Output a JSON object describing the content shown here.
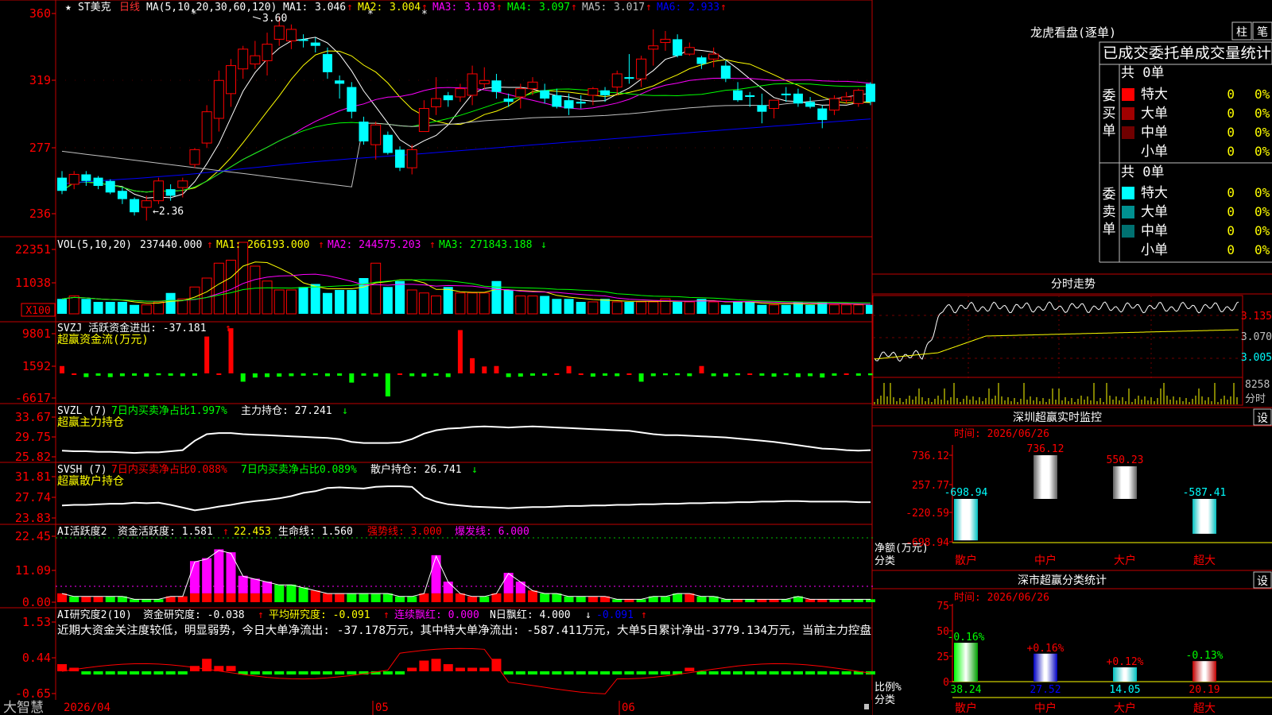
{
  "app": {
    "brand": "大智慧",
    "star": "★"
  },
  "stock": {
    "name": "ST美克",
    "period": "日线",
    "ma_header": "MA(5,10,20,30,60,120)",
    "ma": [
      {
        "label": "MA1:",
        "value": "3.046",
        "color": "#ffffff"
      },
      {
        "label": "MA2:",
        "value": "3.004",
        "color": "#ffff00"
      },
      {
        "label": "MA3:",
        "value": "3.103",
        "color": "#ff00ff"
      },
      {
        "label": "MA4:",
        "value": "3.097",
        "color": "#00ff00"
      },
      {
        "label": "MA5:",
        "value": "3.017",
        "color": "#c0c0c0"
      },
      {
        "label": "MA6:",
        "value": "2.933",
        "color": "#0000ff"
      }
    ],
    "high_marker": "3.60",
    "low_marker": "2.36",
    "arrow_up": "↑",
    "arrow_down": "↓"
  },
  "price_axis": [
    "360",
    "319",
    "277",
    "236"
  ],
  "vol_panel": {
    "title": "VOL(5,10,20)",
    "value": "237440.000",
    "ma1": "MA1: 266193.000",
    "ma2": "MA2: 244575.203",
    "ma3": "MA3: 271843.188",
    "axis": [
      "22351",
      "11038",
      "X100"
    ]
  },
  "svzj_panel": {
    "title": "SVZJ  活跃资金进出: -37.181",
    "subtitle": "超赢资金流(万元)",
    "axis": [
      "9801",
      "1592",
      "-6617"
    ]
  },
  "svzl_panel": {
    "title": "SVZL (7)",
    "net": "7日内买卖净占比1.997%",
    "main": "主力持仓: 27.241",
    "subtitle": "超赢主力持仓",
    "axis": [
      "33.67",
      "29.75",
      "25.82"
    ]
  },
  "svsh_panel": {
    "title": "SVSH (7)",
    "net1": "7日内买卖净占比0.088%",
    "net2": "7日内买卖净占比0.089%",
    "retail": "散户持仓: 26.741",
    "subtitle": "超赢散户持仓",
    "axis": [
      "31.81",
      "27.74",
      "23.83"
    ]
  },
  "ai_active_panel": {
    "title": "AI活跃度2",
    "degree": "资金活跃度: 1.581",
    "v2": "22.453",
    "life": "生命线: 1.560",
    "strong": "强势线: 3.000",
    "burst": "爆发线: 6.000",
    "axis": [
      "22.45",
      "11.09",
      "0.00"
    ]
  },
  "ai_research_panel": {
    "title": "AI研究度2(10)",
    "research": "资金研究度: -0.038",
    "avg": "平均研究度: -0.091",
    "red": "连续飘红: 0.000",
    "nred": "N日飘红: 4.000",
    "last": "-0.091",
    "comment": "近期大资金关注度较低，明显弱势，今日大单净流出: -37.178万元，其中特大单净流出: -587.411万元，大单5日累计净出-3779.134万元，当前主力控盘",
    "axis": [
      "1.53",
      "0.44",
      "-0.65"
    ]
  },
  "date_axis": [
    "2026/04",
    "05",
    "06"
  ],
  "lhkp": {
    "title": "龙虎看盘(逐单)",
    "btn1": "柱",
    "btn2": "笔",
    "subtitle": "已成交委托单成交量统计",
    "buy_label": "委买单",
    "sell_label": "委卖单",
    "buy_total": "共 0单",
    "sell_total": "共 0单",
    "buy_rows": [
      {
        "name": "特大",
        "count": "0",
        "pct": "0%",
        "color": "#ff0000"
      },
      {
        "name": "大单",
        "count": "0",
        "pct": "0%",
        "color": "#a00000"
      },
      {
        "name": "中单",
        "count": "0",
        "pct": "0%",
        "color": "#700000"
      },
      {
        "name": "小单",
        "count": "0",
        "pct": "0%",
        "color": ""
      }
    ],
    "sell_rows": [
      {
        "name": "特大",
        "count": "0",
        "pct": "0%",
        "color": "#00ffff"
      },
      {
        "name": "大单",
        "count": "0",
        "pct": "0%",
        "color": "#009090"
      },
      {
        "name": "中单",
        "count": "0",
        "pct": "0%",
        "color": "#007070"
      },
      {
        "name": "小单",
        "count": "0",
        "pct": "0%",
        "color": ""
      }
    ]
  },
  "intraday": {
    "title": "分时走势",
    "axis": [
      "3.135",
      "3.070",
      "3.005"
    ],
    "vol_label": "8258",
    "time_label": "分时"
  },
  "sz_monitor": {
    "title": "深圳超赢实时监控",
    "btn": "设",
    "time": "时间: 2026/06/26",
    "axis": [
      "736.12",
      "257.77",
      "-220.59",
      "-698.94"
    ],
    "ylabel1": "净额(万元)",
    "ylabel2": "分类",
    "cats": [
      "散户",
      "中户",
      "大户",
      "超大"
    ],
    "labels": [
      "-698.94",
      "736.12",
      "550.23",
      "-587.41"
    ]
  },
  "sz_class": {
    "title": "深市超赢分类统计",
    "btn": "设",
    "time": "时间: 2026/06/26",
    "axis": [
      "75",
      "50",
      "25",
      "0"
    ],
    "ylabel1": "比例%",
    "ylabel2": "分类",
    "cats": [
      "散户",
      "中户",
      "大户",
      "超大"
    ],
    "top_labels": [
      "-0.16%",
      "+0.16%",
      "+0.12%",
      "-0.13%"
    ],
    "bottom_labels": [
      "38.24",
      "27.52",
      "14.05",
      "20.19"
    ]
  },
  "chart_data": [
    {
      "type": "candlestick",
      "title": "ST美克 日线",
      "ylim": [
        2.3,
        3.65
      ],
      "ohlc": [
        [
          2.62,
          2.66,
          2.52,
          2.54
        ],
        [
          2.58,
          2.66,
          2.55,
          2.64
        ],
        [
          2.64,
          2.66,
          2.57,
          2.6
        ],
        [
          2.62,
          2.63,
          2.55,
          2.57
        ],
        [
          2.6,
          2.61,
          2.52,
          2.53
        ],
        [
          2.54,
          2.56,
          2.46,
          2.49
        ],
        [
          2.49,
          2.5,
          2.39,
          2.41
        ],
        [
          2.44,
          2.51,
          2.36,
          2.48
        ],
        [
          2.48,
          2.62,
          2.46,
          2.6
        ],
        [
          2.55,
          2.58,
          2.48,
          2.51
        ],
        [
          2.56,
          2.62,
          2.5,
          2.6
        ],
        [
          2.7,
          2.8,
          2.68,
          2.79
        ],
        [
          2.83,
          3.06,
          2.8,
          3.02
        ],
        [
          2.98,
          3.27,
          2.9,
          3.21
        ],
        [
          3.13,
          3.34,
          3.05,
          3.3
        ],
        [
          3.28,
          3.42,
          3.22,
          3.4
        ],
        [
          3.31,
          3.45,
          3.28,
          3.36
        ],
        [
          3.33,
          3.5,
          3.24,
          3.43
        ],
        [
          3.46,
          3.6,
          3.42,
          3.54
        ],
        [
          3.45,
          3.55,
          3.4,
          3.52
        ],
        [
          3.46,
          3.49,
          3.41,
          3.45
        ],
        [
          3.44,
          3.47,
          3.38,
          3.42
        ],
        [
          3.37,
          3.41,
          3.22,
          3.26
        ],
        [
          3.21,
          3.24,
          3.1,
          3.19
        ],
        [
          3.17,
          3.2,
          2.98,
          3.02
        ],
        [
          2.96,
          2.99,
          2.82,
          2.84
        ],
        [
          2.82,
          2.96,
          2.73,
          2.94
        ],
        [
          2.88,
          2.9,
          2.76,
          2.77
        ],
        [
          2.79,
          2.81,
          2.66,
          2.68
        ],
        [
          2.68,
          2.82,
          2.64,
          2.79
        ],
        [
          2.9,
          3.09,
          2.9,
          3.04
        ],
        [
          3.05,
          3.23,
          3.0,
          3.1
        ],
        [
          3.12,
          3.14,
          3.05,
          3.09
        ],
        [
          3.11,
          3.19,
          3.08,
          3.16
        ],
        [
          3.12,
          3.3,
          3.06,
          3.25
        ],
        [
          3.19,
          3.29,
          3.16,
          3.21
        ],
        [
          3.21,
          3.25,
          3.1,
          3.14
        ],
        [
          3.1,
          3.13,
          3.05,
          3.08
        ],
        [
          3.11,
          3.19,
          3.04,
          3.16
        ],
        [
          3.16,
          3.23,
          3.12,
          3.2
        ],
        [
          3.15,
          3.19,
          3.07,
          3.1
        ],
        [
          3.12,
          3.16,
          3.04,
          3.05
        ],
        [
          3.09,
          3.13,
          3.0,
          3.04
        ],
        [
          3.08,
          3.12,
          3.04,
          3.07
        ],
        [
          3.12,
          3.17,
          3.06,
          3.16
        ],
        [
          3.15,
          3.17,
          3.08,
          3.12
        ],
        [
          3.17,
          3.27,
          3.12,
          3.25
        ],
        [
          3.23,
          3.37,
          3.19,
          3.22
        ],
        [
          3.22,
          3.36,
          3.17,
          3.34
        ],
        [
          3.4,
          3.52,
          3.3,
          3.42
        ],
        [
          3.44,
          3.51,
          3.39,
          3.46
        ],
        [
          3.46,
          3.49,
          3.35,
          3.36
        ],
        [
          3.37,
          3.44,
          3.36,
          3.41
        ],
        [
          3.35,
          3.36,
          3.28,
          3.31
        ],
        [
          3.34,
          3.41,
          3.29,
          3.37
        ],
        [
          3.3,
          3.33,
          3.2,
          3.22
        ],
        [
          3.15,
          3.2,
          3.08,
          3.09
        ],
        [
          3.12,
          3.14,
          3.05,
          3.11
        ],
        [
          3.06,
          3.13,
          2.95,
          3.02
        ],
        [
          3.04,
          3.09,
          2.98,
          3.09
        ],
        [
          3.13,
          3.17,
          3.08,
          3.12
        ],
        [
          3.13,
          3.16,
          3.05,
          3.07
        ],
        [
          3.08,
          3.11,
          3.04,
          3.05
        ],
        [
          3.04,
          3.06,
          2.92,
          2.97
        ],
        [
          3.03,
          3.12,
          3.0,
          3.1
        ],
        [
          3.09,
          3.14,
          3.07,
          3.11
        ],
        [
          3.07,
          3.16,
          3.05,
          3.15
        ],
        [
          3.19,
          3.2,
          3.06,
          3.08
        ]
      ]
    },
    {
      "type": "bar",
      "title": "VOL(5,10,20)",
      "values": [
        5,
        6,
        5,
        4,
        4,
        4,
        3,
        3,
        4,
        7,
        5,
        9,
        12,
        17,
        18,
        24,
        16,
        11,
        8,
        8,
        9,
        10,
        7,
        8,
        8,
        12,
        17,
        9,
        11,
        8,
        7,
        6,
        9,
        7,
        7,
        7,
        11,
        8,
        6,
        6,
        6,
        5,
        5,
        4,
        4,
        5,
        4,
        4,
        4,
        4,
        5,
        4,
        4,
        5,
        4,
        3,
        4,
        4,
        3,
        3,
        3,
        4,
        3,
        4,
        3,
        3,
        3,
        3
      ]
    },
    {
      "type": "bar",
      "title": "超赢资金流(万元)",
      "values": [
        1592,
        0,
        -800,
        -500,
        -800,
        -600,
        -500,
        -700,
        -400,
        -500,
        -600,
        -500,
        8000,
        0,
        9800,
        -1800,
        -900,
        -800,
        -700,
        -600,
        -500,
        -400,
        -600,
        -500,
        -2000,
        -500,
        -700,
        -5000,
        0,
        -600,
        -700,
        -500,
        -800,
        9400,
        3300,
        1500,
        1600,
        -800,
        -700,
        -500,
        -500,
        0,
        1592,
        0,
        -700,
        -500,
        -600,
        0,
        -1800,
        -600,
        -400,
        -400,
        -600,
        1600,
        -600,
        -700,
        -400,
        0,
        -500,
        -700,
        -400,
        -800,
        -600,
        -900,
        -500,
        0,
        -500,
        -400
      ]
    },
    {
      "type": "line",
      "title": "超赢主力持仓",
      "values": [
        26.9,
        26.8,
        26.8,
        26.7,
        26.7,
        26.6,
        26.5,
        26.6,
        26.6,
        26.8,
        27,
        28.7,
        29.9,
        30.1,
        30.1,
        29.9,
        29.8,
        29.7,
        29.6,
        29.5,
        29.4,
        29.3,
        29.2,
        29.0,
        28.5,
        28.3,
        28.3,
        28.3,
        28.4,
        29.0,
        30.0,
        30.6,
        30.9,
        31.0,
        31.2,
        31.3,
        31.2,
        31.1,
        31.2,
        31.3,
        31.2,
        31.1,
        31.0,
        30.9,
        30.8,
        30.7,
        30.6,
        30.5,
        30.2,
        29.9,
        29.7,
        29.7,
        29.6,
        29.5,
        29.4,
        29.3,
        29.1,
        28.9,
        28.7,
        28.5,
        28.2,
        27.9,
        27.6,
        27.3,
        27.2,
        27.0,
        26.9,
        27.0
      ]
    },
    {
      "type": "line",
      "title": "超赢散户持仓",
      "values": [
        26.1,
        26.2,
        26.2,
        26.3,
        26.4,
        26.4,
        26.6,
        26.5,
        26.6,
        26.2,
        25.7,
        25.2,
        25.5,
        25.9,
        26.2,
        26.6,
        26.9,
        27.1,
        27.4,
        27.8,
        28.4,
        28.7,
        29.3,
        29.4,
        29.3,
        29.2,
        29.5,
        29.6,
        29.6,
        29.5,
        27.6,
        26.8,
        26.3,
        26.1,
        25.9,
        25.8,
        25.7,
        25.6,
        25.7,
        25.8,
        25.8,
        25.9,
        26.0,
        26.0,
        26.1,
        26.1,
        26.2,
        26.2,
        26.3,
        26.3,
        26.4,
        26.4,
        26.5,
        26.5,
        26.6,
        26.6,
        26.7,
        26.7,
        26.8,
        26.8,
        26.9,
        26.9,
        26.8,
        26.8,
        26.8,
        26.8,
        26.7,
        26.7
      ]
    },
    {
      "type": "bar",
      "title": "AI活跃度2",
      "values": [
        3,
        2,
        2,
        2,
        2,
        2,
        1,
        1,
        1,
        2,
        2,
        14,
        15,
        18,
        17,
        9,
        8,
        7,
        6,
        6,
        5,
        4,
        3,
        3,
        3,
        3,
        3,
        3,
        2,
        2,
        3,
        16,
        7,
        3,
        2,
        2,
        3,
        10,
        7,
        4,
        3,
        3,
        2,
        2,
        2,
        2,
        1,
        1,
        1,
        2,
        2,
        3,
        3,
        2,
        2,
        1,
        1,
        1,
        1,
        1,
        1,
        2,
        1,
        1,
        1,
        1,
        1,
        1
      ]
    },
    {
      "type": "bar",
      "title": "AI研究度2(10)",
      "values": [
        0.2,
        0.1,
        -0.1,
        -0.1,
        -0.1,
        -0.1,
        -0.1,
        -0.1,
        -0.1,
        -0.1,
        -0.1,
        0.15,
        0.35,
        0.15,
        0.15,
        -0.1,
        -0.1,
        -0.1,
        -0.1,
        -0.1,
        -0.1,
        -0.1,
        -0.1,
        -0.1,
        -0.1,
        -0.1,
        -0.1,
        -0.1,
        -0.1,
        0.1,
        0.3,
        0.35,
        0.2,
        0.1,
        0.1,
        0.1,
        0.35,
        -0.1,
        -0.1,
        -0.1,
        -0.1,
        -0.1,
        -0.1,
        -0.1,
        -0.1,
        -0.1,
        -0.1,
        -0.1,
        -0.1,
        -0.1,
        -0.1,
        -0.1,
        0.1,
        -0.1,
        -0.1,
        -0.1,
        -0.1,
        -0.1,
        -0.1,
        -0.1,
        -0.1,
        -0.1,
        -0.1,
        -0.1,
        -0.1,
        -0.1,
        -0.1,
        -0.1
      ]
    },
    {
      "type": "bar",
      "title": "深圳超赢实时监控",
      "categories": [
        "散户",
        "中户",
        "大户",
        "超大"
      ],
      "values": [
        -698.94,
        736.12,
        550.23,
        -587.41
      ],
      "ylim": [
        -698.94,
        736.12
      ]
    },
    {
      "type": "bar",
      "title": "深市超赢分类统计",
      "categories": [
        "散户",
        "中户",
        "大户",
        "超大"
      ],
      "values": [
        38.24,
        27.52,
        14.05,
        20.19
      ],
      "ylim": [
        0,
        75
      ]
    }
  ]
}
